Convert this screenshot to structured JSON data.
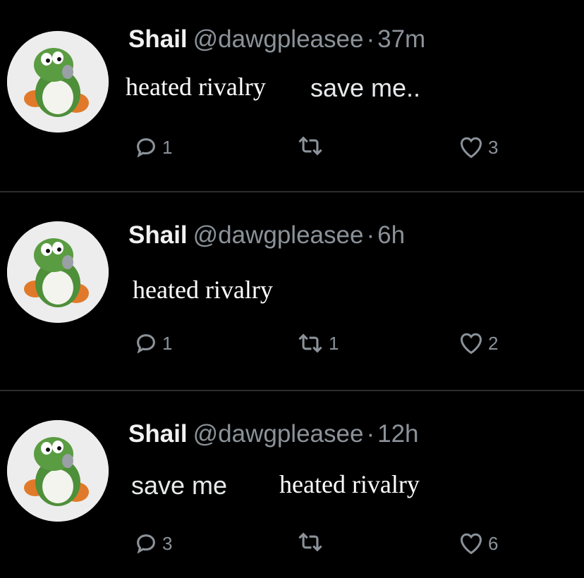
{
  "tweets": [
    {
      "name": "Shail",
      "handle": "@dawgpleasee",
      "time": "37m",
      "text_parts": [
        "heated rivalry",
        "save me.."
      ],
      "replies": "1",
      "retweets": "",
      "likes": "3"
    },
    {
      "name": "Shail",
      "handle": "@dawgpleasee",
      "time": "6h",
      "text_parts": [
        "heated rivalry"
      ],
      "replies": "1",
      "retweets": "1",
      "likes": "2"
    },
    {
      "name": "Shail",
      "handle": "@dawgpleasee",
      "time": "12h",
      "text_parts": [
        "save me",
        "heated rivalry"
      ],
      "replies": "3",
      "retweets": "",
      "likes": "6"
    }
  ],
  "separator": "·",
  "colors": {
    "background": "#000000",
    "text": "#e7e9ea",
    "muted": "#8b9299",
    "divider": "#2a2c2e",
    "avatar_bg": "#ededed"
  },
  "icons": {
    "reply": "speech-bubble-icon",
    "retweet": "retweet-arrows-icon",
    "like": "heart-icon",
    "avatar": "yoshi-figure-icon"
  }
}
